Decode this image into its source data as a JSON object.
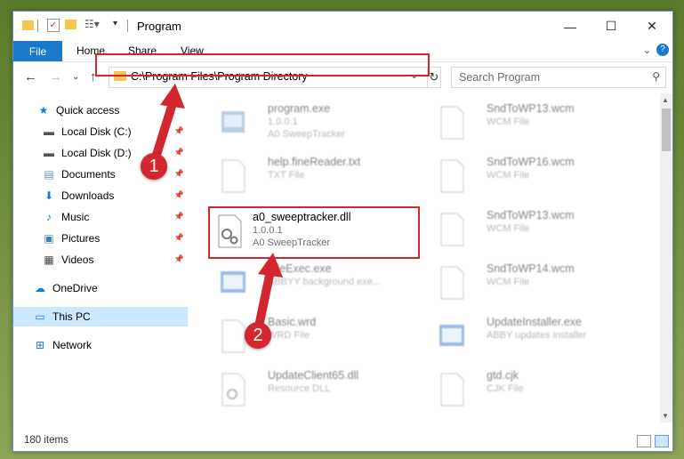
{
  "window": {
    "title": "Program"
  },
  "ribbon": {
    "tabs": [
      "File",
      "Home",
      "Share",
      "View"
    ]
  },
  "address": {
    "path": "C:\\Program Files\\Program Directory"
  },
  "search": {
    "placeholder": "Search Program"
  },
  "sidebar": {
    "items": [
      {
        "label": "Quick access",
        "icon": "star-icon"
      },
      {
        "label": "Local Disk (C:)",
        "icon": "drive-icon"
      },
      {
        "label": "Local Disk (D:)",
        "icon": "drive-icon"
      },
      {
        "label": "Documents",
        "icon": "documents-icon"
      },
      {
        "label": "Downloads",
        "icon": "download-icon"
      },
      {
        "label": "Music",
        "icon": "music-icon"
      },
      {
        "label": "Pictures",
        "icon": "pictures-icon"
      },
      {
        "label": "Videos",
        "icon": "videos-icon"
      },
      {
        "label": "OneDrive",
        "icon": "cloud-icon"
      },
      {
        "label": "This PC",
        "icon": "computer-icon"
      },
      {
        "label": "Network",
        "icon": "network-icon"
      }
    ]
  },
  "files": [
    {
      "name": "program.exe",
      "line2": "1.0.0.1",
      "line3": "A0 SweepTracker"
    },
    {
      "name": "SndToWP13.wcm",
      "line2": "WCM File",
      "line3": ""
    },
    {
      "name": "help.fineReader.txt",
      "line2": "TXT File",
      "line3": ""
    },
    {
      "name": "SndToWP16.wcm",
      "line2": "WCM File",
      "line3": ""
    },
    {
      "name": "a0_sweeptracker.dll",
      "line2": "1.0.0.1",
      "line3": "A0 SweepTracker"
    },
    {
      "name": "SndToWP13.wcm",
      "line2": "WCM File",
      "line3": ""
    },
    {
      "name": "FileExec.exe",
      "line2": "ABBYY background exe...",
      "line3": ""
    },
    {
      "name": "SndToWP14.wcm",
      "line2": "WCM File",
      "line3": ""
    },
    {
      "name": "Basic.wrd",
      "line2": "WRD File",
      "line3": ""
    },
    {
      "name": "UpdateInstaller.exe",
      "line2": "ABBY updates installer",
      "line3": ""
    },
    {
      "name": "UpdateClient65.dll",
      "line2": "Resource DLL",
      "line3": ""
    },
    {
      "name": "gtd.cjk",
      "line2": "CJK File",
      "line3": ""
    }
  ],
  "status": {
    "items": "180 items"
  },
  "annotations": {
    "step1": "1",
    "step2": "2"
  },
  "colors": {
    "accent": "#1979ca",
    "highlight": "#d3262f",
    "selection": "#cce8ff"
  }
}
